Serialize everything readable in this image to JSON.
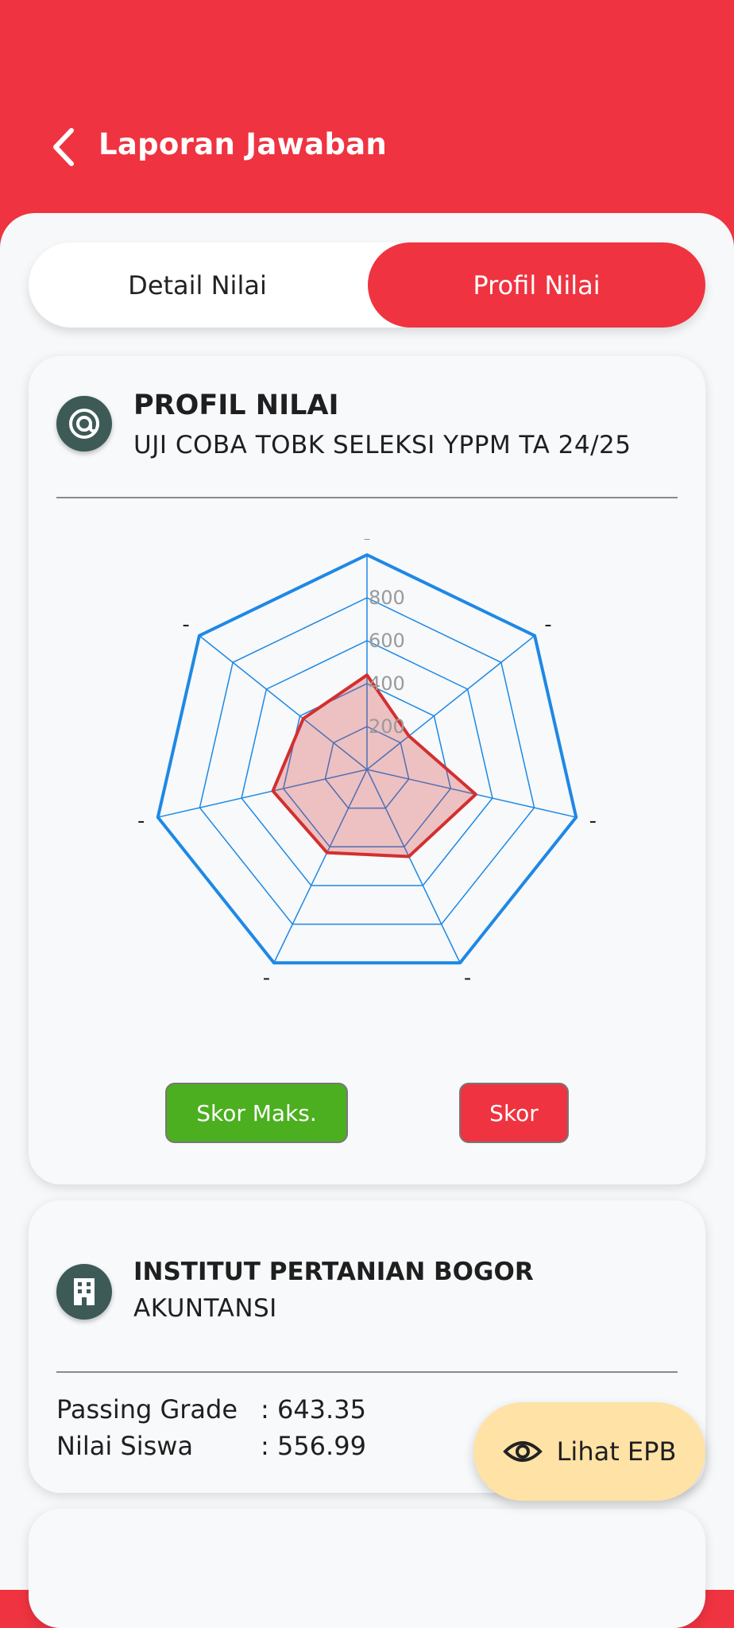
{
  "header": {
    "title": "Laporan Jawaban"
  },
  "tabs": {
    "left": "Detail Nilai",
    "right": "Profil Nilai"
  },
  "profile": {
    "title": "PROFIL NILAI",
    "subtitle": "UJI COBA TOBK SELEKSI YPPM TA 24/25",
    "legend_max": "Skor Maks.",
    "legend_score": "Skor"
  },
  "chart_data": {
    "type": "radar",
    "categories": [
      "-",
      "-",
      "-",
      "-",
      "-",
      "-",
      "-"
    ],
    "rlim": [
      0,
      1000
    ],
    "ticks": [
      "200",
      "400",
      "600",
      "800"
    ],
    "series": [
      {
        "values": [
          1000,
          1000,
          1000,
          1000,
          1000,
          1000,
          1000
        ],
        "color": "#1e88e5"
      },
      {
        "values": [
          440,
          250,
          520,
          450,
          430,
          450,
          380
        ],
        "color": "#d32f2f"
      }
    ],
    "grid": true
  },
  "institution": {
    "name": "INSTITUT PERTANIAN BOGOR",
    "major": "AKUNTANSI",
    "passing_grade_label": "Passing Grade",
    "passing_grade_value": ": 643.35",
    "student_score_label": "Nilai Siswa",
    "student_score_value": ": 556.99"
  },
  "fab": {
    "label": "Lihat EPB"
  },
  "colors": {
    "primary": "#ef3340",
    "max": "#4caf1f",
    "grid": "#1e88e5",
    "fab": "#ffe2a6"
  }
}
